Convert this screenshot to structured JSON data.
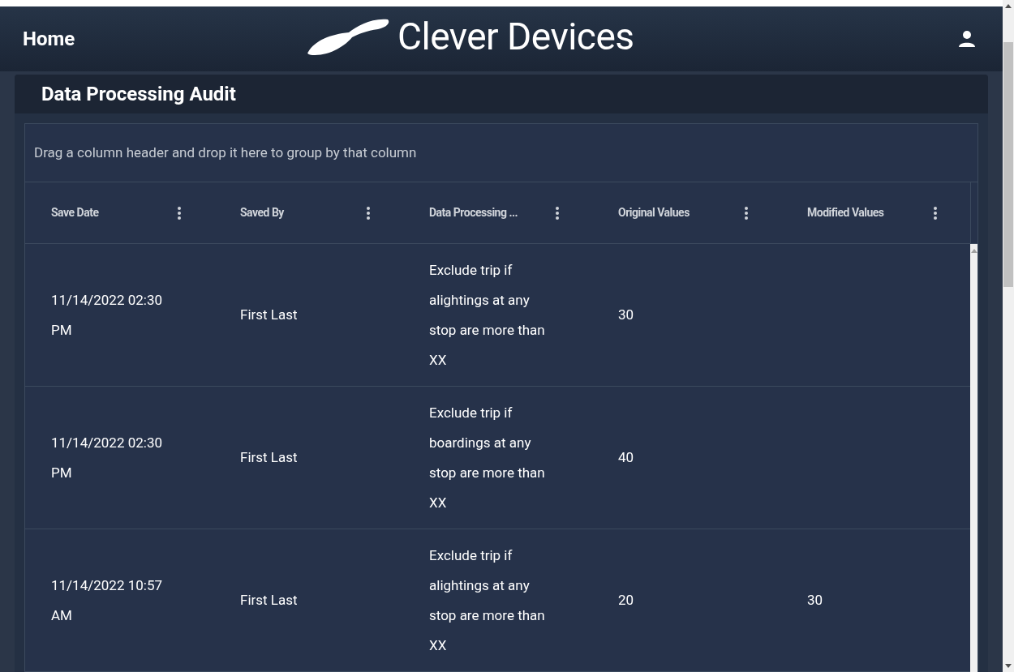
{
  "header": {
    "nav_title": "Home",
    "brand": "Clever Devices"
  },
  "card": {
    "title": "Data Processing Audit"
  },
  "grid": {
    "group_panel_hint": "Drag a column header and drop it here to group by that column",
    "columns": [
      "Save Date",
      "Saved By",
      "Data Processing ...",
      "Original Values",
      "Modified Values"
    ],
    "rows": [
      {
        "cells": [
          "11/14/2022 02:30 PM",
          "First Last",
          "Exclude trip if alightings at any stop are more than XX",
          "30",
          ""
        ]
      },
      {
        "cells": [
          "11/14/2022 02:30 PM",
          "First Last",
          "Exclude trip if boardings at any stop are more than XX",
          "40",
          ""
        ]
      },
      {
        "cells": [
          "11/14/2022 10:57 AM",
          "First Last",
          "Exclude trip if alightings at any stop are more than XX",
          "20",
          "30"
        ]
      }
    ]
  }
}
